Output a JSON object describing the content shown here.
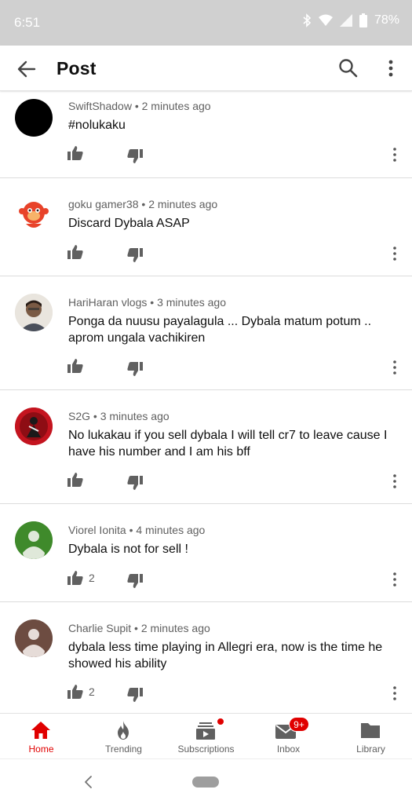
{
  "status_bar": {
    "time": "6:51",
    "battery": "78%"
  },
  "app_bar": {
    "title": "Post"
  },
  "comments": [
    {
      "author": "SwiftShadow",
      "time": "2 minutes ago",
      "text": "#nolukaku",
      "likes": ""
    },
    {
      "author": "goku gamer38",
      "time": "2 minutes ago",
      "text": "Discard Dybala ASAP",
      "likes": ""
    },
    {
      "author": "HariHaran vlogs",
      "time": "3 minutes ago",
      "text": "Ponga da nuusu payalagula ... Dybala matum potum .. aprom ungala vachikiren",
      "likes": ""
    },
    {
      "author": "S2G",
      "time": "3 minutes ago",
      "text": "No lukakau if you sell dybala I will tell cr7 to leave cause I have his number and I am his bff",
      "likes": ""
    },
    {
      "author": "Viorel Ionita",
      "time": "4 minutes ago",
      "text": "Dybala is not for sell !",
      "likes": "2"
    },
    {
      "author": "Charlie Supit",
      "time": "2 minutes ago",
      "text": "dybala less time playing in Allegri era, now is the time he showed his ability",
      "likes": "2"
    }
  ],
  "separator": "•",
  "bottom_nav": {
    "items": [
      {
        "label": "Home",
        "icon": "home-icon"
      },
      {
        "label": "Trending",
        "icon": "flame-icon"
      },
      {
        "label": "Subscriptions",
        "icon": "subscriptions-icon"
      },
      {
        "label": "Inbox",
        "icon": "mail-icon"
      },
      {
        "label": "Library",
        "icon": "folder-icon"
      }
    ],
    "inbox_badge": "9+",
    "active_color": "#e00000"
  }
}
